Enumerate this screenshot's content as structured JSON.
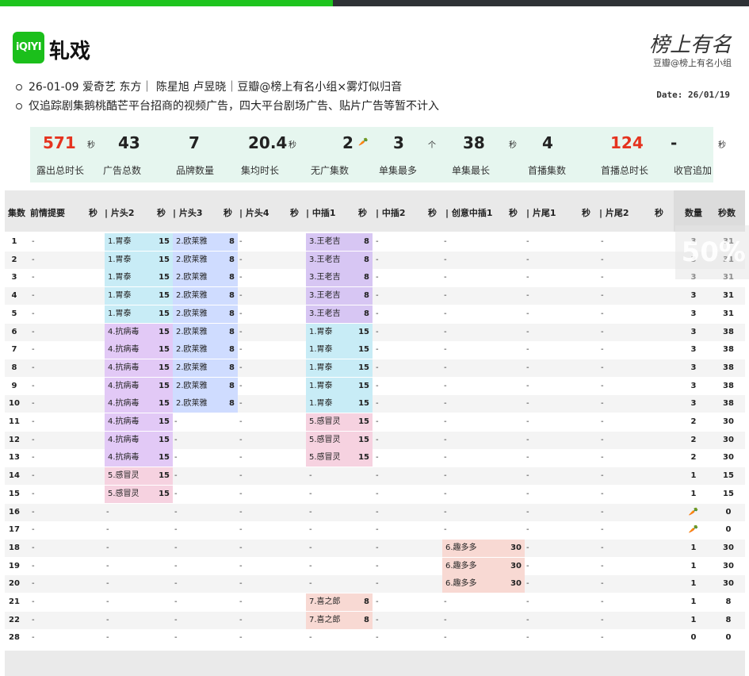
{
  "header": {
    "logo_text": "iQIYI",
    "title": "轧戏",
    "brand_signature": "榜上有名",
    "brand_sub": "豆瓣@榜上有名小组",
    "info_line_1": "26-01-09 爱奇艺 东方｜ 陈星旭 卢昱晓｜豆瓣@榜上有名小组×雾灯似归音",
    "info_line_2": "仅追踪剧集鹅桃酷芒平台招商的视频广告，四大平台剧场广告、贴片广告等暂不计入",
    "date": "Date: 26/01/19"
  },
  "stats": [
    {
      "value": "571",
      "unit": "秒",
      "label": "露出总时长",
      "red": true
    },
    {
      "value": "43",
      "unit": "",
      "label": "广告总数",
      "red": false
    },
    {
      "value": "7",
      "unit": "",
      "label": "品牌数量",
      "red": false
    },
    {
      "value": "20.4",
      "unit": "秒",
      "label": "集均时长",
      "red": false
    },
    {
      "value": "2",
      "unit": "🥕",
      "label": "无广集数",
      "red": false
    },
    {
      "value": "3",
      "unit": "个",
      "label": "单集最多",
      "red": false
    },
    {
      "value": "38",
      "unit": "秒",
      "label": "单集最长",
      "red": false
    },
    {
      "value": "4",
      "unit": "",
      "label": "首播集数",
      "red": false
    },
    {
      "value": "124",
      "unit": "",
      "label": "首播总时长",
      "red": true
    },
    {
      "value": "-",
      "unit": "秒",
      "label": "收官追加",
      "red": false
    }
  ],
  "columns": [
    "集数",
    "前情提要",
    "秒",
    "| 片头2",
    "秒",
    "| 片头3",
    "秒",
    "| 片头4",
    "秒",
    "| 中插1",
    "秒",
    "| 中插2",
    "秒",
    "| 创意中插1",
    "秒",
    "| 片尾1",
    "秒",
    "| 片尾2",
    "秒",
    "数量",
    "秒数"
  ],
  "rows": [
    {
      "ep": "1",
      "recap": "-",
      "h2": [
        "1.胃泰",
        "15"
      ],
      "h3": [
        "2.欧莱雅",
        "8"
      ],
      "h4": "-",
      "m1": [
        "3.王老吉",
        "8"
      ],
      "m2": "-",
      "cm": "-",
      "e1": "-",
      "e2": "-",
      "count": "3",
      "secs": "31"
    },
    {
      "ep": "2",
      "recap": "-",
      "h2": [
        "1.胃泰",
        "15"
      ],
      "h3": [
        "2.欧莱雅",
        "8"
      ],
      "h4": "-",
      "m1": [
        "3.王老吉",
        "8"
      ],
      "m2": "-",
      "cm": "-",
      "e1": "-",
      "e2": "-",
      "count": "3",
      "secs": "31"
    },
    {
      "ep": "3",
      "recap": "-",
      "h2": [
        "1.胃泰",
        "15"
      ],
      "h3": [
        "2.欧莱雅",
        "8"
      ],
      "h4": "-",
      "m1": [
        "3.王老吉",
        "8"
      ],
      "m2": "-",
      "cm": "-",
      "e1": "-",
      "e2": "-",
      "count": "3",
      "secs": "31"
    },
    {
      "ep": "4",
      "recap": "-",
      "h2": [
        "1.胃泰",
        "15"
      ],
      "h3": [
        "2.欧莱雅",
        "8"
      ],
      "h4": "-",
      "m1": [
        "3.王老吉",
        "8"
      ],
      "m2": "-",
      "cm": "-",
      "e1": "-",
      "e2": "-",
      "count": "3",
      "secs": "31"
    },
    {
      "ep": "5",
      "recap": "-",
      "h2": [
        "1.胃泰",
        "15"
      ],
      "h3": [
        "2.欧莱雅",
        "8"
      ],
      "h4": "-",
      "m1": [
        "3.王老吉",
        "8"
      ],
      "m2": "-",
      "cm": "-",
      "e1": "-",
      "e2": "-",
      "count": "3",
      "secs": "31"
    },
    {
      "ep": "6",
      "recap": "-",
      "h2": [
        "4.抗病毒",
        "15"
      ],
      "h3": [
        "2.欧莱雅",
        "8"
      ],
      "h4": "-",
      "m1": [
        "1.胃泰",
        "15"
      ],
      "m2": "-",
      "cm": "-",
      "e1": "-",
      "e2": "-",
      "count": "3",
      "secs": "38"
    },
    {
      "ep": "7",
      "recap": "-",
      "h2": [
        "4.抗病毒",
        "15"
      ],
      "h3": [
        "2.欧莱雅",
        "8"
      ],
      "h4": "-",
      "m1": [
        "1.胃泰",
        "15"
      ],
      "m2": "-",
      "cm": "-",
      "e1": "-",
      "e2": "-",
      "count": "3",
      "secs": "38"
    },
    {
      "ep": "8",
      "recap": "-",
      "h2": [
        "4.抗病毒",
        "15"
      ],
      "h3": [
        "2.欧莱雅",
        "8"
      ],
      "h4": "-",
      "m1": [
        "1.胃泰",
        "15"
      ],
      "m2": "-",
      "cm": "-",
      "e1": "-",
      "e2": "-",
      "count": "3",
      "secs": "38"
    },
    {
      "ep": "9",
      "recap": "-",
      "h2": [
        "4.抗病毒",
        "15"
      ],
      "h3": [
        "2.欧莱雅",
        "8"
      ],
      "h4": "-",
      "m1": [
        "1.胃泰",
        "15"
      ],
      "m2": "-",
      "cm": "-",
      "e1": "-",
      "e2": "-",
      "count": "3",
      "secs": "38"
    },
    {
      "ep": "10",
      "recap": "-",
      "h2": [
        "4.抗病毒",
        "15"
      ],
      "h3": [
        "2.欧莱雅",
        "8"
      ],
      "h4": "-",
      "m1": [
        "1.胃泰",
        "15"
      ],
      "m2": "-",
      "cm": "-",
      "e1": "-",
      "e2": "-",
      "count": "3",
      "secs": "38"
    },
    {
      "ep": "11",
      "recap": "-",
      "h2": [
        "4.抗病毒",
        "15"
      ],
      "h3": "-",
      "h4": "-",
      "m1": [
        "5.感冒灵",
        "15"
      ],
      "m2": "-",
      "cm": "-",
      "e1": "-",
      "e2": "-",
      "count": "2",
      "secs": "30"
    },
    {
      "ep": "12",
      "recap": "-",
      "h2": [
        "4.抗病毒",
        "15"
      ],
      "h3": "-",
      "h4": "-",
      "m1": [
        "5.感冒灵",
        "15"
      ],
      "m2": "-",
      "cm": "-",
      "e1": "-",
      "e2": "-",
      "count": "2",
      "secs": "30"
    },
    {
      "ep": "13",
      "recap": "-",
      "h2": [
        "4.抗病毒",
        "15"
      ],
      "h3": "-",
      "h4": "-",
      "m1": [
        "5.感冒灵",
        "15"
      ],
      "m2": "-",
      "cm": "-",
      "e1": "-",
      "e2": "-",
      "count": "2",
      "secs": "30"
    },
    {
      "ep": "14",
      "recap": "-",
      "h2": [
        "5.感冒灵",
        "15"
      ],
      "h3": "-",
      "h4": "-",
      "m1": "-",
      "m2": "-",
      "cm": "-",
      "e1": "-",
      "e2": "-",
      "count": "1",
      "secs": "15"
    },
    {
      "ep": "15",
      "recap": "-",
      "h2": [
        "5.感冒灵",
        "15"
      ],
      "h3": "-",
      "h4": "-",
      "m1": "-",
      "m2": "-",
      "cm": "-",
      "e1": "-",
      "e2": "-",
      "count": "1",
      "secs": "15"
    },
    {
      "ep": "16",
      "recap": "-",
      "h2": "-",
      "h3": "-",
      "h4": "-",
      "m1": "-",
      "m2": "-",
      "cm": "-",
      "e1": "-",
      "e2": "-",
      "count": "🥕",
      "secs": "0"
    },
    {
      "ep": "17",
      "recap": "-",
      "h2": "-",
      "h3": "-",
      "h4": "-",
      "m1": "-",
      "m2": "-",
      "cm": "-",
      "e1": "-",
      "e2": "-",
      "count": "🥕",
      "secs": "0"
    },
    {
      "ep": "18",
      "recap": "-",
      "h2": "-",
      "h3": "-",
      "h4": "-",
      "m1": "-",
      "m2": "-",
      "cm": [
        "6.趣多多",
        "30"
      ],
      "e1": "-",
      "e2": "-",
      "count": "1",
      "secs": "30"
    },
    {
      "ep": "19",
      "recap": "-",
      "h2": "-",
      "h3": "-",
      "h4": "-",
      "m1": "-",
      "m2": "-",
      "cm": [
        "6.趣多多",
        "30"
      ],
      "e1": "-",
      "e2": "-",
      "count": "1",
      "secs": "30"
    },
    {
      "ep": "20",
      "recap": "-",
      "h2": "-",
      "h3": "-",
      "h4": "-",
      "m1": "-",
      "m2": "-",
      "cm": [
        "6.趣多多",
        "30"
      ],
      "e1": "-",
      "e2": "-",
      "count": "1",
      "secs": "30"
    },
    {
      "ep": "21",
      "recap": "-",
      "h2": "-",
      "h3": "-",
      "h4": "-",
      "m1": [
        "7.喜之郎",
        "8"
      ],
      "m2": "-",
      "cm": "-",
      "e1": "-",
      "e2": "-",
      "count": "1",
      "secs": "8"
    },
    {
      "ep": "22",
      "recap": "-",
      "h2": "-",
      "h3": "-",
      "h4": "-",
      "m1": [
        "7.喜之郎",
        "8"
      ],
      "m2": "-",
      "cm": "-",
      "e1": "-",
      "e2": "-",
      "count": "1",
      "secs": "8"
    },
    {
      "ep": "28",
      "recap": "-",
      "h2": "-",
      "h3": "-",
      "h4": "-",
      "m1": "-",
      "m2": "-",
      "cm": "-",
      "e1": "-",
      "e2": "-",
      "count": "0",
      "secs": "0"
    }
  ],
  "colors": {
    "weitai": "#c8ecf6",
    "kangbingdu": "#e2c9f6",
    "oulaiya": "#cfdcff",
    "wanglaoji": "#d7c6f3",
    "ganmaoling": "#f6d2e0",
    "quduoduo": "#f8d9d3",
    "xizhilang": "#f8d9d3",
    "accent_green": "#1ec41e",
    "accent_red": "#e5331f"
  }
}
